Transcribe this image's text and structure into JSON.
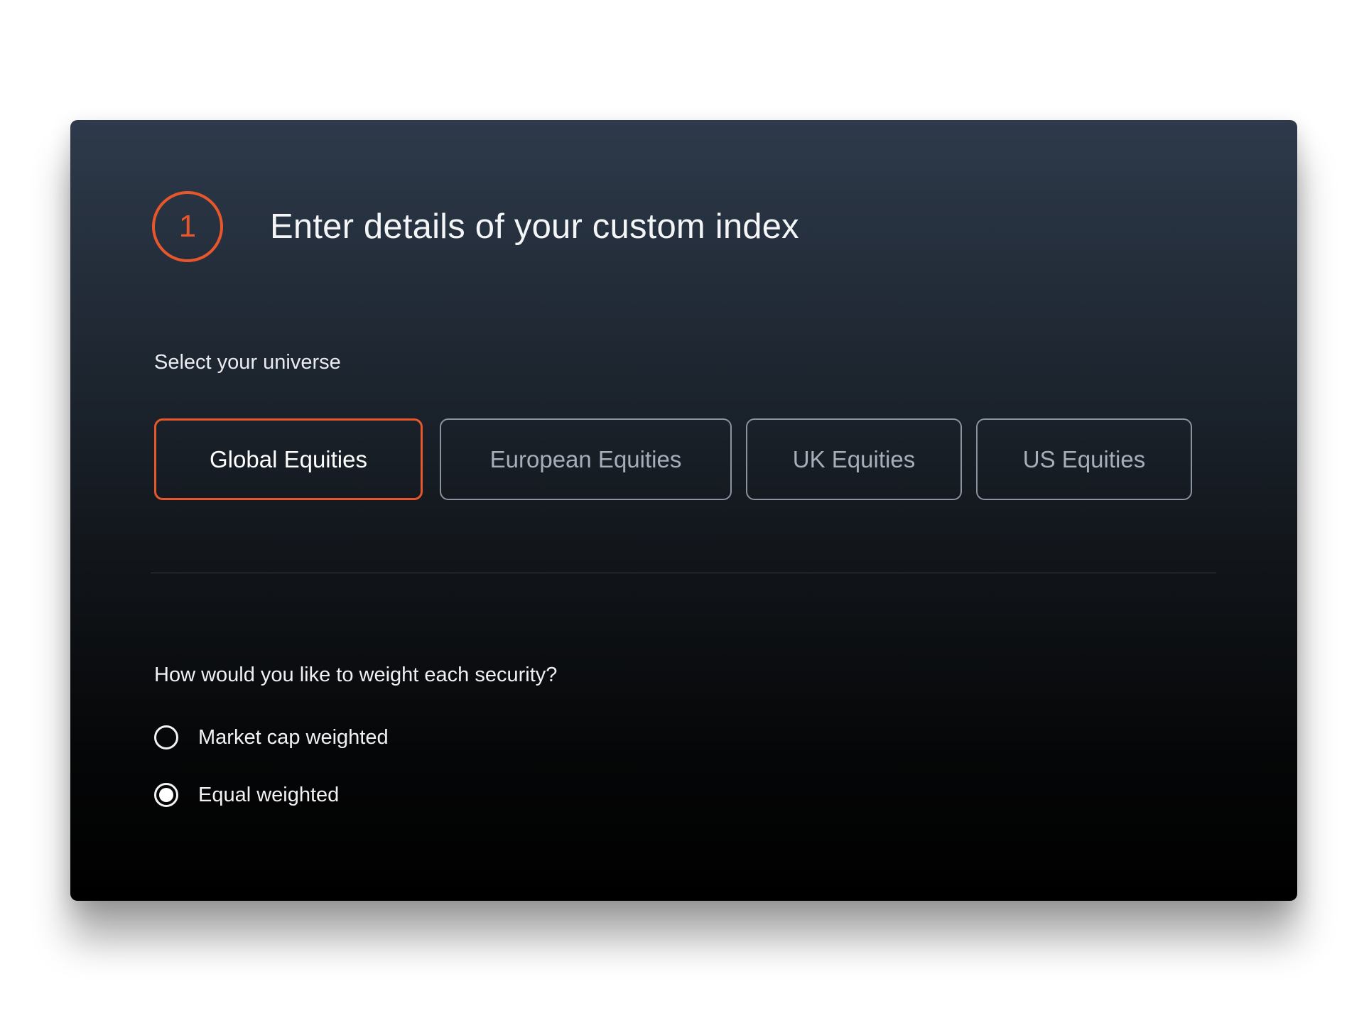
{
  "step": {
    "number": "1",
    "title": "Enter details of your custom index"
  },
  "universe": {
    "label": "Select your universe",
    "options": [
      {
        "label": "Global Equities",
        "selected": true
      },
      {
        "label": "European Equities",
        "selected": false
      },
      {
        "label": "UK Equities",
        "selected": false
      },
      {
        "label": "US Equities",
        "selected": false
      }
    ]
  },
  "weighting": {
    "label": "How would you like to weight each security?",
    "options": [
      {
        "label": "Market cap weighted",
        "selected": false
      },
      {
        "label": "Equal weighted",
        "selected": true
      }
    ]
  },
  "colors": {
    "accent": "#e8572b",
    "card_top": "#2e3a4b",
    "card_bottom": "#000000",
    "option_border": "#8b93a0",
    "option_text": "#a7aeb9"
  }
}
